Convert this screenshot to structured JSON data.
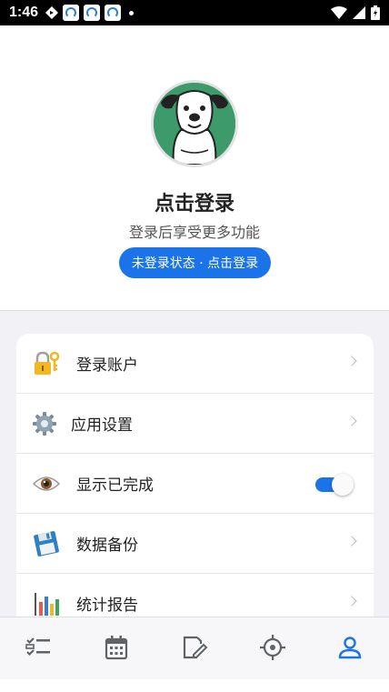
{
  "status_bar": {
    "time": "1:46",
    "icons": [
      "navigation-diamond-icon",
      "app-notification-icon",
      "app-notification-icon",
      "app-notification-icon",
      "dot-icon",
      "wifi-icon",
      "cell-signal-icon",
      "battery-charging-icon"
    ]
  },
  "profile": {
    "avatar_icon": "dog-avatar",
    "username": "点击登录",
    "subtitle": "登录后享受更多功能",
    "status_pill": "未登录状态 · 点击登录"
  },
  "menu": {
    "items": [
      {
        "label": "登录账户",
        "icon": "lock-key-icon",
        "trailing": "chevron"
      },
      {
        "label": "应用设置",
        "icon": "gear-icon",
        "trailing": "chevron"
      },
      {
        "label": "显示已完成",
        "icon": "eye-icon",
        "trailing": "toggle",
        "toggle_on": true
      },
      {
        "label": "数据备份",
        "icon": "floppy-disk-icon",
        "trailing": "chevron"
      },
      {
        "label": "统计报告",
        "icon": "bar-chart-icon",
        "trailing": "chevron"
      }
    ]
  },
  "tabbar": {
    "tabs": [
      {
        "icon": "task-list-icon",
        "active": false
      },
      {
        "icon": "calendar-icon",
        "active": false
      },
      {
        "icon": "edit-note-icon",
        "active": false
      },
      {
        "icon": "target-icon",
        "active": false
      },
      {
        "icon": "profile-icon",
        "active": true
      }
    ]
  },
  "colors": {
    "accent": "#1a73e8",
    "tab_inactive": "#5f6368",
    "status_bar": "#000000",
    "avatar_bg": "#3d9a6a"
  }
}
